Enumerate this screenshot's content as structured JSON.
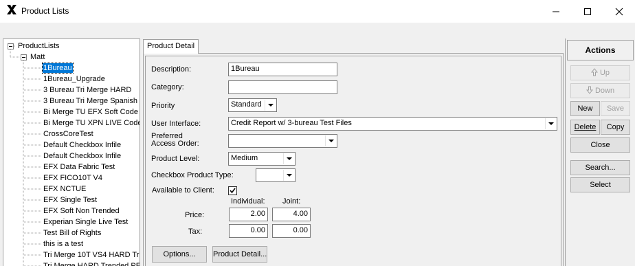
{
  "window": {
    "title": "Product Lists"
  },
  "tree": {
    "root_label": "ProductLists",
    "group_label": "Matt",
    "items": [
      "1Bureau",
      "1Bureau_Upgrade",
      "3 Bureau Tri Merge HARD",
      "3 Bureau Tri Merge Spanish",
      "Bi Merge TU EFX Soft Code",
      "Bi Merge TU XPN LIVE Code",
      "CrossCoreTest",
      "Default Checkbox Infile",
      "Default Checkbox Infile",
      "EFX Data Fabric Test",
      "EFX FICO10T V4",
      "EFX NCTUE",
      "EFX Single Test",
      "EFX Soft Non Trended",
      "Experian Single Live Test",
      "Test Bill of Rights",
      "this is a test",
      "Tri Merge 10T VS4 HARD Tr",
      "Tri Merge HARD Trended PE"
    ],
    "selected_index": 0
  },
  "tab": {
    "label": "Product Detail"
  },
  "form": {
    "description_label": "Description:",
    "description_value": "1Bureau",
    "category_label": "Category:",
    "category_value": "",
    "priority_label": "Priority",
    "priority_value": "Standard",
    "ui_label": "User Interface:",
    "ui_value": "Credit Report w/ 3-bureau Test Files",
    "access_label_1": "Preferred",
    "access_label_2": "Access Order:",
    "access_value": "",
    "level_label": "Product Level:",
    "level_value": "Medium",
    "checkbox_type_label": "Checkbox Product Type:",
    "checkbox_type_value": "",
    "available_label": "Available to Client:",
    "available_checked": true,
    "individual_header": "Individual:",
    "joint_header": "Joint:",
    "price_label": "Price:",
    "price_individual": "2.00",
    "price_joint": "4.00",
    "tax_label": "Tax:",
    "tax_individual": "0.00",
    "tax_joint": "0.00",
    "options_button": "Options...",
    "product_detail_button": "Product Detail..."
  },
  "actions": {
    "header": "Actions",
    "up": "Up",
    "down": "Down",
    "new": "New",
    "save": "Save",
    "delete": "Delete",
    "copy": "Copy",
    "close": "Close",
    "search": "Search...",
    "select": "Select"
  },
  "colors": {
    "selection": "#0078d7",
    "window_bg": "#f0f0f0"
  }
}
